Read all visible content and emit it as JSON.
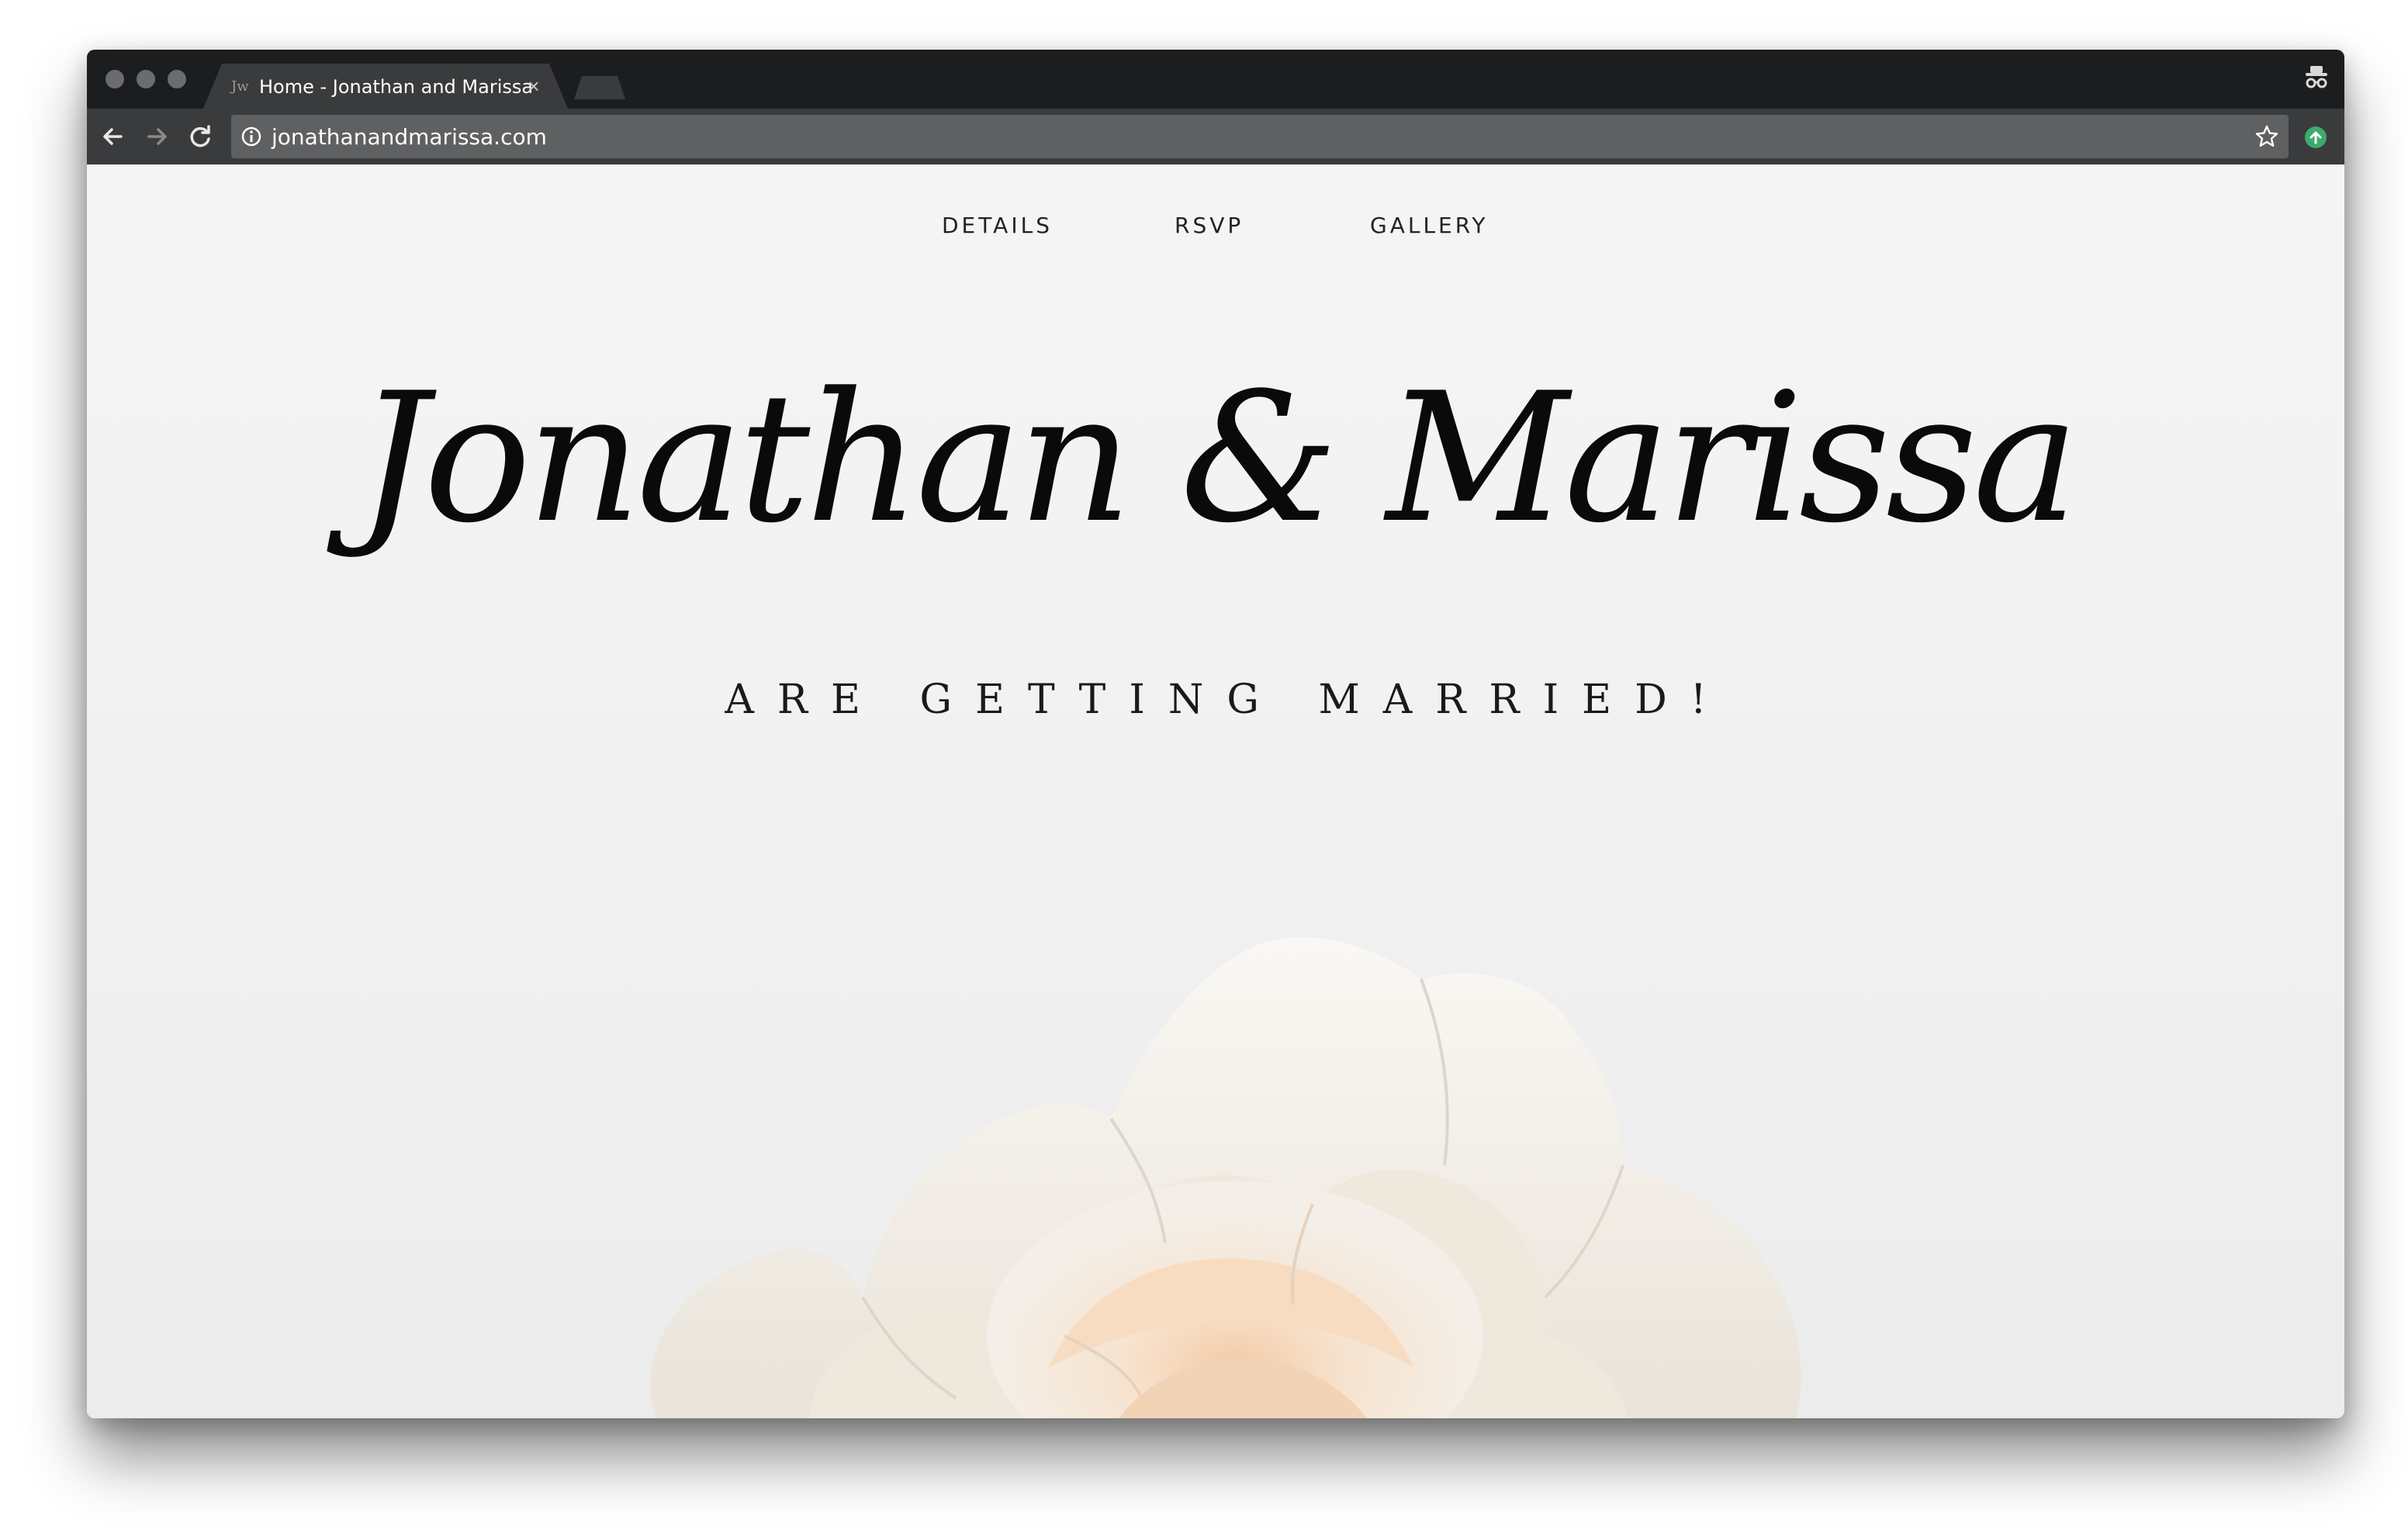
{
  "browser": {
    "tab": {
      "title": "Home - Jonathan and Marissa",
      "close_glyph": "×",
      "favicon_glyph": "Jw"
    },
    "address_bar": {
      "url": "jonathanandmarissa.com"
    }
  },
  "site": {
    "nav": {
      "details": "DETAILS",
      "rsvp": "RSVP",
      "gallery": "GALLERY"
    },
    "hero": {
      "names": "Jonathan & Marissa",
      "subtitle": "ARE GETTING MARRIED!"
    }
  },
  "colors": {
    "tab_strip": "#1c1d1f",
    "toolbar": "#3a3b3d",
    "omnibox": "#5f6062",
    "page_background": "#f2f2f2",
    "text": "#0a0a0a",
    "extension_icon": "#3daa6e",
    "rose_tint": "#f7d9bd"
  },
  "icons": {
    "back": "back-arrow-icon",
    "forward": "forward-arrow-icon",
    "reload": "reload-icon",
    "info": "info-icon",
    "star": "star-icon",
    "incognito": "incognito-icon",
    "extension": "upload-arrow-icon"
  }
}
